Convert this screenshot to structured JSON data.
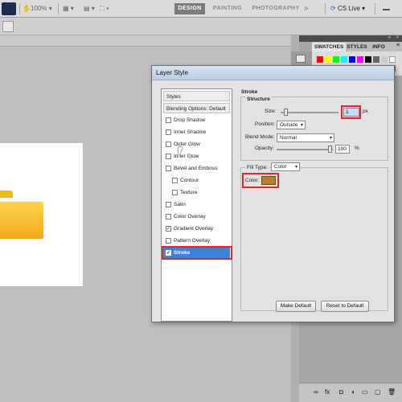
{
  "appbar": {
    "zoom": "100%",
    "workspaces": [
      "DESIGN",
      "PAINTING",
      "PHOTOGRAPHY"
    ],
    "active_workspace": "DESIGN",
    "more": "»",
    "cslive": "CS Live"
  },
  "panels": {
    "tabs": [
      "SWATCHES",
      "STYLES",
      "INFO"
    ]
  },
  "dialog": {
    "title": "Layer Style",
    "styles_list": [
      {
        "label": "Styles",
        "header": true
      },
      {
        "label": "Blending Options: Default",
        "header": true
      },
      {
        "label": "Drop Shadow",
        "checked": false
      },
      {
        "label": "Inner Shadow",
        "checked": false
      },
      {
        "label": "Outer Glow",
        "checked": false
      },
      {
        "label": "Inner Glow",
        "checked": false
      },
      {
        "label": "Bevel and Emboss",
        "checked": false
      },
      {
        "label": "Contour",
        "checked": false
      },
      {
        "label": "Texture",
        "checked": false
      },
      {
        "label": "Satin",
        "checked": false
      },
      {
        "label": "Color Overlay",
        "checked": false
      },
      {
        "label": "Gradient Overlay",
        "checked": true
      },
      {
        "label": "Pattern Overlay",
        "checked": false
      },
      {
        "label": "Stroke",
        "checked": true,
        "selected": true
      }
    ],
    "stroke": {
      "section_title": "Stroke",
      "structure_title": "Structure",
      "size_label": "Size:",
      "size_value": "1",
      "size_unit": "px",
      "position_label": "Position:",
      "position_value": "Outside",
      "blend_label": "Blend Mode:",
      "blend_value": "Normal",
      "opacity_label": "Opacity:",
      "opacity_value": "100",
      "opacity_unit": "%",
      "filltype_label": "Fill Type:",
      "filltype_value": "Color",
      "color_label": "Color:",
      "color_value": "#b8802a",
      "make_default": "Make Default",
      "reset_default": "Reset to Default"
    }
  }
}
